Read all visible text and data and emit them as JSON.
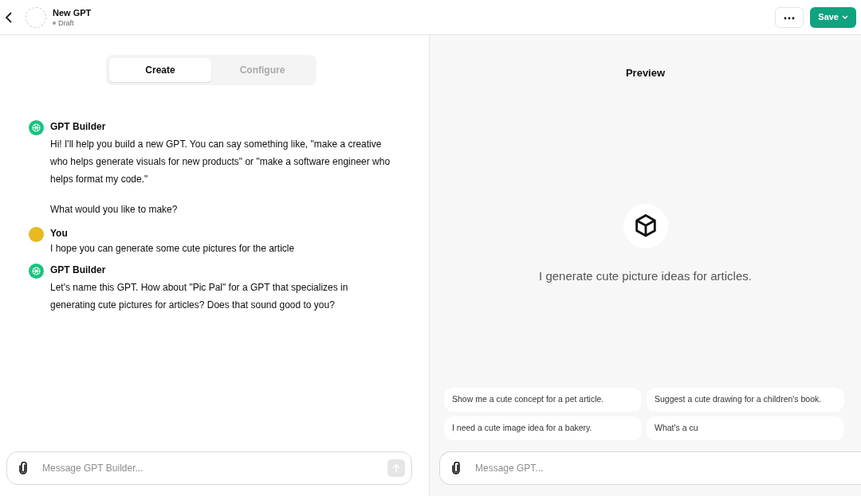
{
  "header": {
    "title": "New GPT",
    "status": "Draft",
    "save_label": "Save"
  },
  "tabs": [
    {
      "label": "Create",
      "selected": true
    },
    {
      "label": "Configure",
      "selected": false
    }
  ],
  "messages": [
    {
      "kind": "assistant",
      "author": "GPT Builder",
      "paragraphs": [
        "Hi! I'll help you build a new GPT. You can say something like, \"make a creative who helps generate visuals for new products\" or \"make a software engineer who helps format my code.\"",
        "What would you like to make?"
      ]
    },
    {
      "kind": "user",
      "author": "You",
      "paragraphs": [
        "I hope you can generate some cute pictures for the article"
      ]
    },
    {
      "kind": "assistant",
      "author": "GPT Builder",
      "paragraphs": [
        "Let's name this GPT. How about \"Pic Pal\" for a GPT that specializes in generating cute pictures for articles? Does that sound good to you?"
      ]
    }
  ],
  "builder_input": {
    "placeholder": "Message GPT Builder..."
  },
  "preview": {
    "title": "Preview",
    "description": "I generate cute picture ideas for articles.",
    "suggestions": [
      "Show me a cute concept for a pet article.",
      "Suggest a cute drawing for a children's book.",
      "I need a cute image idea for a bakery.",
      "What's a cu"
    ],
    "input": {
      "placeholder": "Message GPT..."
    }
  }
}
